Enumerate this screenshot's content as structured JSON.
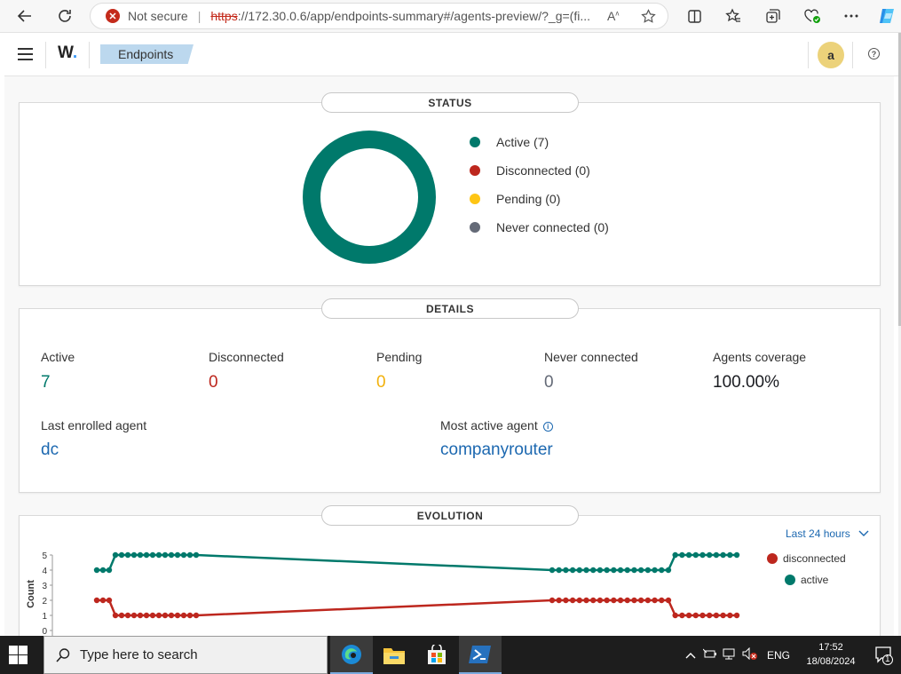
{
  "browser": {
    "security": "Not secure",
    "url_scheme": "https",
    "url_rest": "://172.30.0.6/app/endpoints-summary#/agents-preview/?_g=(fi..."
  },
  "header": {
    "logo": "W",
    "breadcrumb": "Endpoints",
    "avatar": "a"
  },
  "status": {
    "title": "STATUS",
    "legend": [
      {
        "label": "Active (7)",
        "color": "#00796b"
      },
      {
        "label": "Disconnected (0)",
        "color": "#bd271e"
      },
      {
        "label": "Pending (0)",
        "color": "#fec514"
      },
      {
        "label": "Never connected (0)",
        "color": "#646a77"
      }
    ]
  },
  "details": {
    "title": "DETAILS",
    "stats": [
      {
        "label": "Active",
        "value": "7",
        "color": "#00796b"
      },
      {
        "label": "Disconnected",
        "value": "0",
        "color": "#bd271e"
      },
      {
        "label": "Pending",
        "value": "0",
        "color": "#f2b10c"
      },
      {
        "label": "Never connected",
        "value": "0",
        "color": "#646a77"
      },
      {
        "label": "Agents coverage",
        "value": "100.00%",
        "color": "#1a1c21"
      }
    ],
    "last_enrolled_label": "Last enrolled agent",
    "last_enrolled_value": "dc",
    "most_active_label": "Most active agent",
    "most_active_value": "companyrouter"
  },
  "evolution": {
    "title": "EVOLUTION",
    "range": "Last 24 hours",
    "legend": [
      {
        "label": "disconnected",
        "color": "#bd271e"
      },
      {
        "label": "active",
        "color": "#00796b"
      }
    ]
  },
  "chart_data": {
    "type": "line",
    "ylabel": "Count",
    "ylim": [
      0,
      5
    ],
    "yticks": [
      "0",
      "1",
      "2",
      "3",
      "4",
      "5"
    ],
    "series": [
      {
        "name": "active",
        "color": "#00796b",
        "values": [
          4,
          4,
          4,
          5,
          5,
          5,
          5,
          5,
          5,
          5,
          5,
          5,
          5,
          5,
          5,
          5,
          5,
          4,
          4,
          4,
          4,
          4,
          4,
          4,
          4,
          4,
          4,
          4,
          4,
          4,
          4,
          4,
          4,
          4,
          4,
          5,
          5,
          5,
          5,
          5,
          5,
          5,
          5,
          5,
          5
        ]
      },
      {
        "name": "disconnected",
        "color": "#bd271e",
        "values": [
          2,
          2,
          2,
          1,
          1,
          1,
          1,
          1,
          1,
          1,
          1,
          1,
          1,
          1,
          1,
          1,
          1,
          2,
          2,
          2,
          2,
          2,
          2,
          2,
          2,
          2,
          2,
          2,
          2,
          2,
          2,
          2,
          2,
          2,
          2,
          1,
          1,
          1,
          1,
          1,
          1,
          1,
          1,
          1,
          1
        ]
      }
    ]
  },
  "taskbar": {
    "search_placeholder": "Type here to search",
    "lang": "ENG",
    "time": "17:52",
    "date": "18/08/2024",
    "notif_count": "1"
  }
}
